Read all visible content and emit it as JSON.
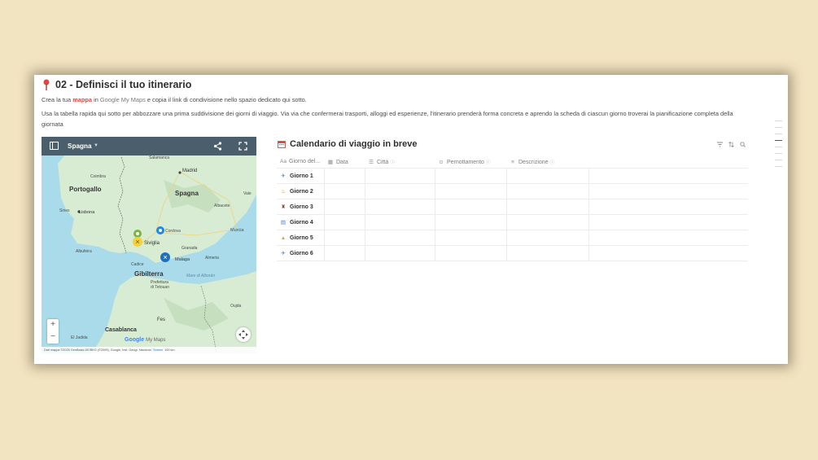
{
  "section": {
    "title": "02 - Definisci il tuo itinerario",
    "intro_prefix": "Crea la tua ",
    "intro_highlight": "mappa",
    "intro_mid": " in ",
    "intro_link": "Google My Maps",
    "intro_suffix": " e copia il link di condivisione nello spazio dedicato qui sotto.",
    "paragraph": "Usa la tabella rapida qui sotto per abbozzare una prima suddivisione dei giorni di viaggio. Via via che confermerai trasporti, alloggi ed esperienze, l'itinerario prenderà forma concreta e aprendo la scheda di ciascun giorno troverai la pianificazione completa della giornata"
  },
  "map": {
    "title": "Spagna",
    "labels": {
      "salamanca": "Salamanca",
      "madrid": "Madrid",
      "coimbra": "Coimbra",
      "portogallo": "Portogallo",
      "spagna": "Spagna",
      "valencia": "Vale",
      "lisbona": "Lisbona",
      "sines": "Sines",
      "albacete": "Albacete",
      "cordova": "Cordova",
      "murcia": "Murcia",
      "siviglia": "Siviglia",
      "granada": "Granada",
      "albufeira": "Albufeira",
      "malaga": "Malaga",
      "almeria": "Almeria",
      "cadice": "Cadice",
      "gibilterra": "Gibilterra",
      "prefettura": "Prefettura",
      "tetouan": "di Tetouan",
      "mare": "Mare di Alborán",
      "casablanca": "Casablanca",
      "fes": "Fes",
      "el_jadida": "El Jadida",
      "oujda": "Oujda"
    },
    "zoom_in": "+",
    "zoom_out": "−",
    "logo": "Google",
    "logo_suffix": "My Maps",
    "attribution": "Dati mappa ©2025 GeoBasis-DE/BKG (©2009), Google, Inst. Geogr. Nacional",
    "terms": "Termini",
    "scale": "100 km"
  },
  "calendar": {
    "title": "Calendario di viaggio in breve",
    "columns": [
      {
        "icon": "Aa",
        "label": "Giorno del...",
        "info": false
      },
      {
        "icon": "▦",
        "label": "Data",
        "info": false
      },
      {
        "icon": "☰",
        "label": "Città",
        "info": true
      },
      {
        "icon": "⊙",
        "label": "Pernottamento",
        "info": true
      },
      {
        "icon": "≡",
        "label": "Descrizione",
        "info": true
      }
    ],
    "rows": [
      {
        "emoji": "✈",
        "label": "Giorno 1"
      },
      {
        "emoji": "♨",
        "label": "Giorno 2"
      },
      {
        "emoji": "♜",
        "label": "Giorno 3"
      },
      {
        "emoji": "▤",
        "label": "Giorno 4"
      },
      {
        "emoji": "▲",
        "label": "Giorno 5"
      },
      {
        "emoji": "✈",
        "label": "Giorno 6"
      }
    ]
  },
  "colors": {
    "background": "#f3e4c1",
    "accent_red": "#e0483f",
    "map_header": "#4a5f6b",
    "sea": "#a9dbea",
    "land": "#d7ecd3"
  }
}
